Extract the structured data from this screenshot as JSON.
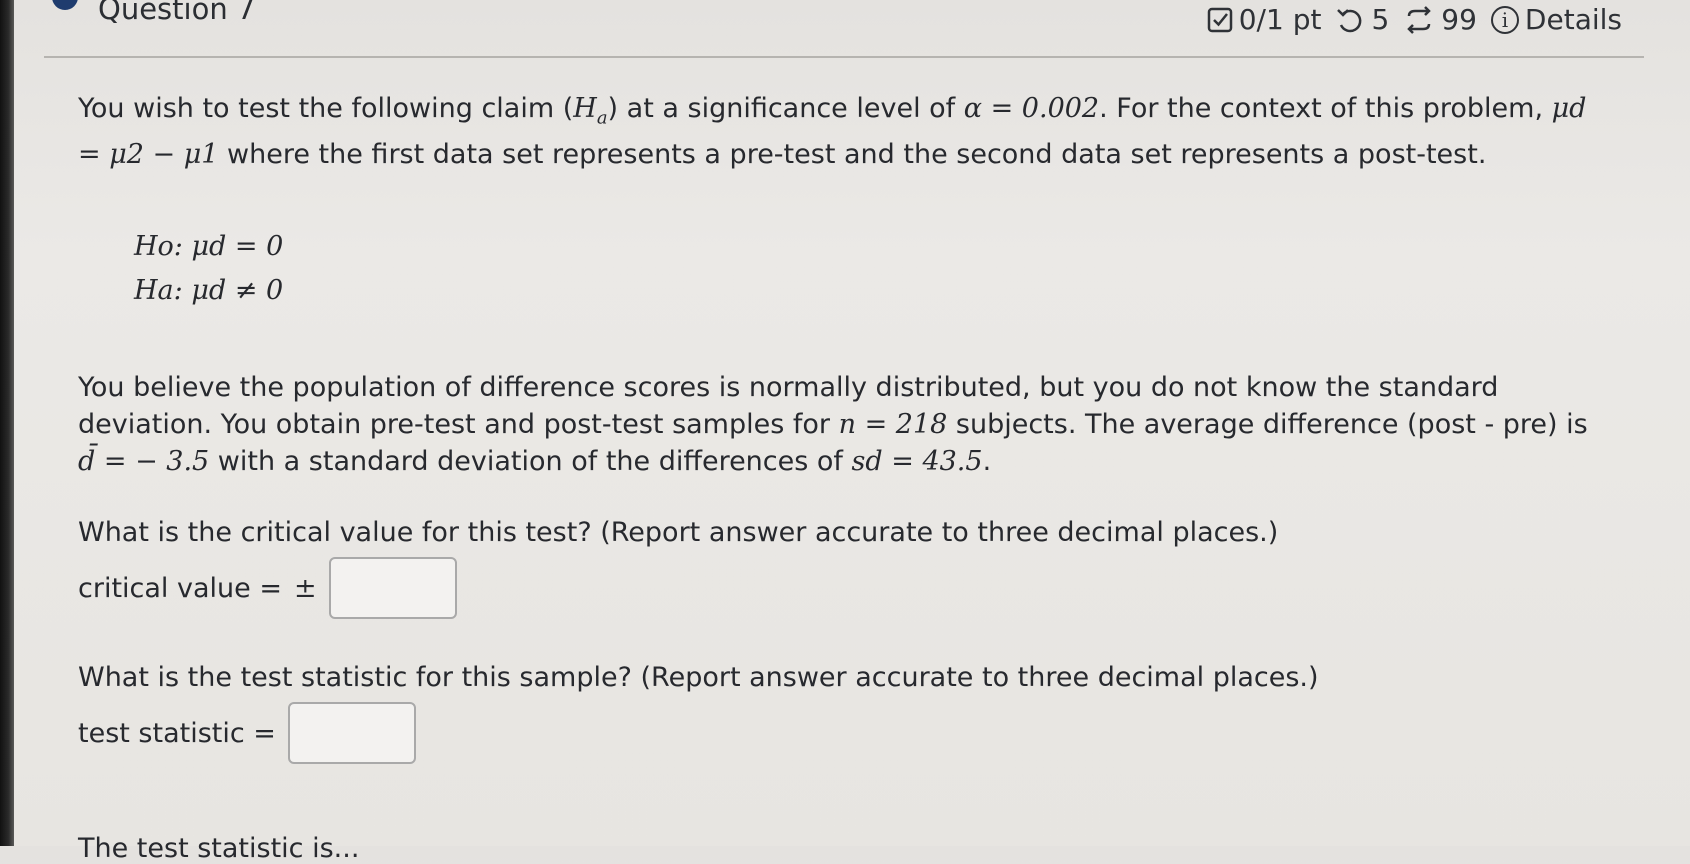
{
  "header": {
    "question_title": "Question 7",
    "score": "0/1 pt",
    "retries": "5",
    "attempts": "99",
    "details_label": "Details",
    "icons": [
      "checkbox-icon",
      "undo-icon",
      "repeat-icon",
      "info-icon"
    ]
  },
  "intro": {
    "text_a": "You wish to test the following claim (",
    "Ha": "H",
    "Ha_sub": "a",
    "text_b": ") at a significance level of ",
    "alpha_expr": "α = 0.002",
    "text_c": ". For the context of this problem, ",
    "mu_expr": "μd = μ2 − μ1",
    "text_d": " where the first data set represents a pre-test and the second data set represents a post-test."
  },
  "hypotheses": {
    "null": "Ho: μd = 0",
    "alt": "Ha: μd ≠ 0"
  },
  "context": {
    "text_a": "You believe the population of difference scores is normally distributed, but you do not know the standard deviation. You obtain pre-test and post-test samples for ",
    "n_expr": "n = 218",
    "text_b": " subjects. The average difference (post - pre) is ",
    "dbar_expr": "d̄ = − 3.5",
    "text_c": " with a standard deviation of the differences of ",
    "sd_expr": "sd = 43.5",
    "text_d": "."
  },
  "question1": {
    "prompt": "What is the critical value for this test? (Report answer accurate to three decimal places.)",
    "label": "critical value = ",
    "pm": "±",
    "value": ""
  },
  "question2": {
    "prompt": "What is the test statistic for this sample? (Report answer accurate to three decimal places.)",
    "label": "test statistic = ",
    "value": ""
  },
  "trailing_text": "The test statistic is..."
}
